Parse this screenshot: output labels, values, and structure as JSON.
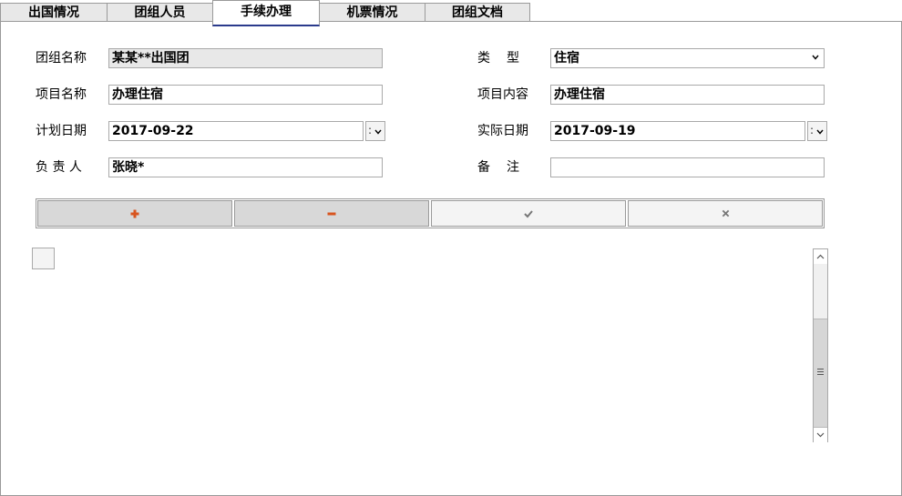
{
  "tabs": [
    {
      "label": "出国情况"
    },
    {
      "label": "团组人员"
    },
    {
      "label": "手续办理",
      "active": true
    },
    {
      "label": "机票情况"
    },
    {
      "label": "团组文档"
    }
  ],
  "form": {
    "group_name": {
      "label": "团组名称",
      "value": "某某**出国团"
    },
    "type": {
      "label": "类　型",
      "value": "住宿"
    },
    "project_name": {
      "label": "项目名称",
      "value": "办理住宿"
    },
    "project_content": {
      "label": "项目内容",
      "value": "办理住宿"
    },
    "planned_date": {
      "label": "计划日期",
      "value": "2017-09-22"
    },
    "actual_date": {
      "label": "实际日期",
      "value": "2017-09-19"
    },
    "responsible": {
      "label": "负 责 人",
      "value": "张晓*"
    },
    "remarks": {
      "label": "备　注",
      "value": ""
    }
  },
  "toolbar": {
    "add_icon": "plus-icon",
    "remove_icon": "minus-icon",
    "confirm_icon": "check-icon",
    "cancel_icon": "close-icon"
  },
  "colors": {
    "accent_tab_underline": "#2a3a8c",
    "action_icon": "#d8551f",
    "disabled_icon": "#777777",
    "readonly_bg": "#e8e8e8"
  }
}
